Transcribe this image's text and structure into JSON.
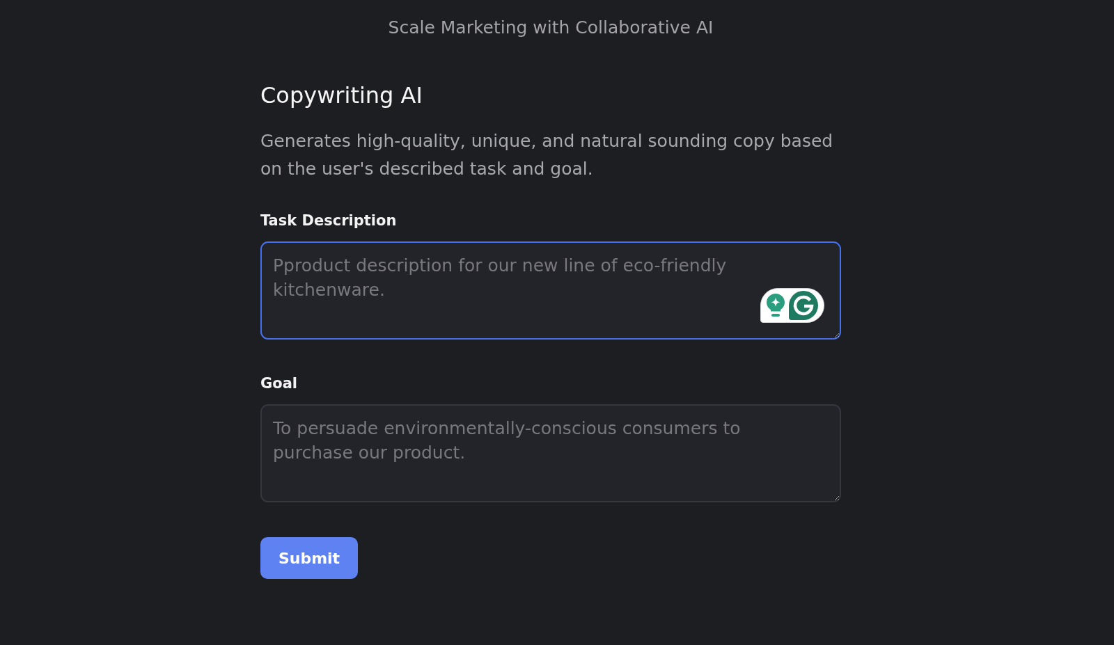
{
  "header": {
    "title": "Scale Marketing with Collaborative AI"
  },
  "tool": {
    "title": "Copywriting AI",
    "description": "Generates high-quality, unique, and natural sounding copy based on the user's described task and goal."
  },
  "fields": [
    {
      "label": "Task Description",
      "placeholder": "Pproduct description for our new line of eco-friendly kitchenware.",
      "focused": true,
      "assistant_badge": true
    },
    {
      "label": "Goal",
      "placeholder": "To persuade environmentally-conscious consumers to purchase our product.",
      "focused": false,
      "assistant_badge": false
    }
  ],
  "submit_button": {
    "label": "Submit"
  }
}
